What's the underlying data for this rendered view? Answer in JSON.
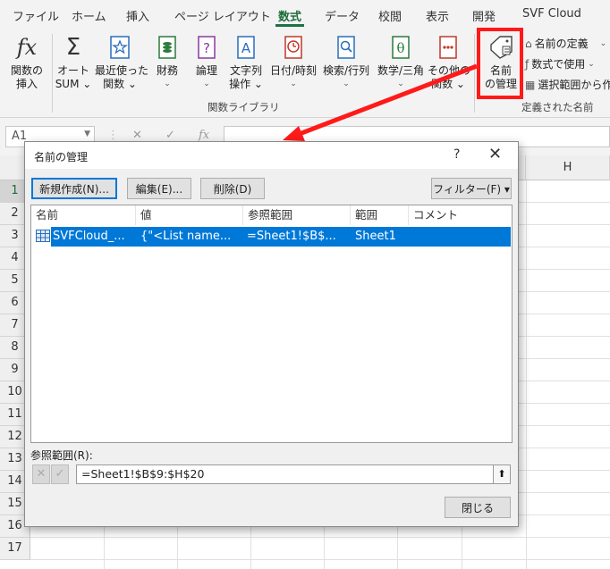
{
  "ribbon_tabs": [
    "ファイル",
    "ホーム",
    "挿入",
    "ページ レイアウト",
    "数式",
    "データ",
    "校閲",
    "表示",
    "開発",
    "SVF Cloud"
  ],
  "active_tab": "数式",
  "ribbon": {
    "insert_function": [
      "関数の",
      "挿入"
    ],
    "autosum": [
      "オート",
      "SUM ⌄"
    ],
    "recent": [
      "最近使った",
      "関数 ⌄"
    ],
    "financial": [
      "財務",
      "⌄"
    ],
    "logical": [
      "論理",
      "⌄"
    ],
    "text": [
      "文字列",
      "操作 ⌄"
    ],
    "datetime": [
      "日付/時刻",
      "⌄"
    ],
    "lookup": [
      "検索/行列",
      "⌄"
    ],
    "math": [
      "数学/三角",
      "⌄"
    ],
    "other": [
      "その他の",
      "関数 ⌄"
    ],
    "name_manager": [
      "名前",
      "の管理"
    ],
    "define_name": "名前の定義",
    "use_in_formula": "数式で使用",
    "create_from_selection": "選択範囲から作",
    "group_library": "関数ライブラリ",
    "group_names": "定義された名前",
    "highlight_color": "#ff1a1a"
  },
  "formula_bar": {
    "namebox": "A1",
    "fx": "fx",
    "cancel": "✕",
    "enter": "✓"
  },
  "grid": {
    "columns": [
      "",
      "",
      "",
      "",
      "",
      "",
      "",
      "H"
    ],
    "rows": [
      "1",
      "2",
      "3",
      "4",
      "5",
      "6",
      "7",
      "8",
      "9",
      "10",
      "11",
      "12",
      "13",
      "14",
      "15",
      "16",
      "17"
    ]
  },
  "dialog": {
    "title": "名前の管理",
    "help": "?",
    "close_x": "✕",
    "new_button": "新規作成(N)...",
    "edit_button": "編集(E)...",
    "delete_button": "削除(D)",
    "filter_button": "フィルター(F) ▾",
    "columns": [
      "名前",
      "値",
      "参照範囲",
      "範囲",
      "コメント"
    ],
    "rows": [
      {
        "name": "SVFCloud_...",
        "value": "{\"<List name...",
        "refers_to": "=Sheet1!$B$...",
        "scope": "Sheet1",
        "comment": ""
      }
    ],
    "refers_to_label": "参照範囲(R):",
    "refers_to_value": "=Sheet1!$B$9:$H$20",
    "close_button": "閉じる",
    "accent": "#0078d7"
  }
}
